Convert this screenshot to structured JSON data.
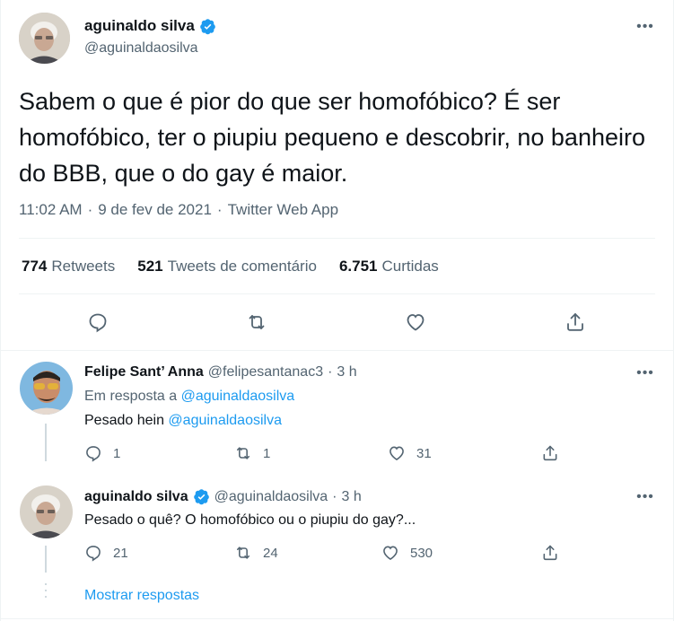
{
  "main_tweet": {
    "author_name": "aguinaldo silva",
    "author_handle": "@aguinaldaosilva",
    "text": "Sabem o que é pior do que ser homofóbico? É ser homofóbico, ter o piupiu pequeno e descobrir, no banheiro do BBB, que o do gay é maior.",
    "time": "11:02 AM",
    "date": "9 de fev de 2021",
    "app": "Twitter Web App",
    "sep": "·",
    "stats": {
      "retweets_count": "774",
      "retweets_label": "Retweets",
      "quotes_count": "521",
      "quotes_label": "Tweets de comentário",
      "likes_count": "6.751",
      "likes_label": "Curtidas"
    }
  },
  "replies": [
    {
      "author_name": "Felipe Sant’ Anna",
      "author_handle": "@felipesantanac3",
      "sep": "·",
      "time": "3 h",
      "reply_prefix": "Em resposta a",
      "reply_to": "@aguinaldaosilva",
      "text": "Pesado hein",
      "text_mention": "@aguinaldaosilva",
      "reply_count": "1",
      "retweet_count": "1",
      "like_count": "31"
    },
    {
      "author_name": "aguinaldo silva",
      "author_handle": "@aguinaldaosilva",
      "sep": "·",
      "time": "3 h",
      "text": "Pesado o quê? O homofóbico ou o piupiu do gay?...",
      "reply_count": "21",
      "retweet_count": "24",
      "like_count": "530"
    }
  ],
  "show_replies_label": "Mostrar respostas",
  "colors": {
    "accent": "#1d9bf0",
    "secondary_text": "#536471",
    "primary_text": "#0f1419",
    "divider": "#eff3f4"
  },
  "icons": [
    "verified-badge-icon",
    "more-icon",
    "reply-icon",
    "retweet-icon",
    "like-icon",
    "share-icon"
  ]
}
